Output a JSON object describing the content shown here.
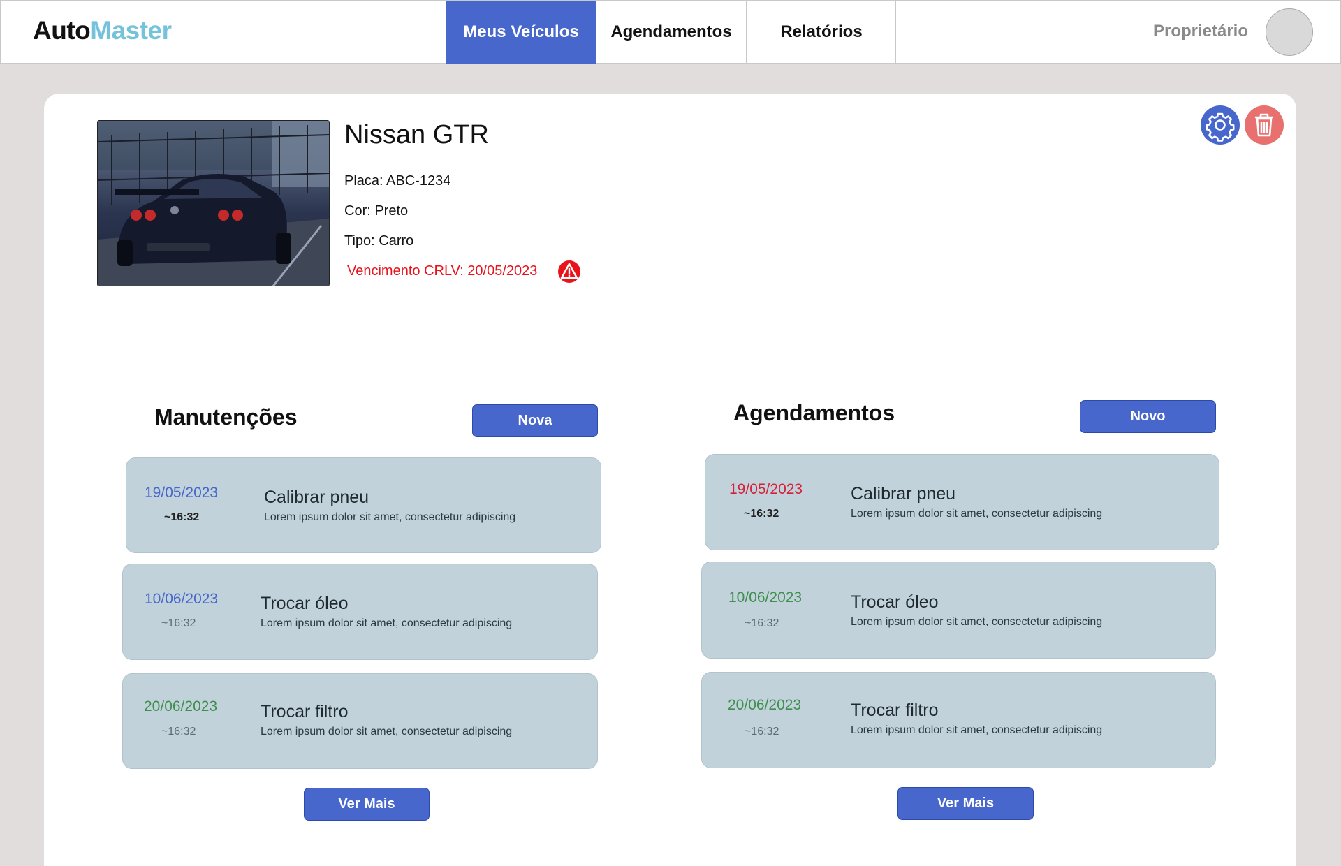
{
  "header": {
    "logo_part1": "Auto",
    "logo_part2": "Master",
    "tabs": [
      {
        "label": "Meus Veículos",
        "active": true
      },
      {
        "label": "Agendamentos",
        "active": false
      },
      {
        "label": "Relatórios",
        "active": false
      }
    ],
    "user_role": "Proprietário"
  },
  "vehicle": {
    "name": "Nissan GTR",
    "plate": "Placa: ABC-1234",
    "color": "Cor: Preto",
    "type": "Tipo: Carro",
    "crlv_due": "Vencimento CRLV: 20/05/2023"
  },
  "maintenance": {
    "title": "Manutenções",
    "new_button": "Nova",
    "more_button": "Ver Mais",
    "items": [
      {
        "date": "19/05/2023",
        "time": "~16:32",
        "title": "Calibrar pneu",
        "desc": "Lorem ipsum dolor sit amet, consectetur adipiscing",
        "date_color": "#4767cc"
      },
      {
        "date": "10/06/2023",
        "time": "~16:32",
        "title": "Trocar óleo",
        "desc": "Lorem ipsum dolor sit amet, consectetur adipiscing",
        "date_color": "#4767cc"
      },
      {
        "date": "20/06/2023",
        "time": "~16:32",
        "title": "Trocar filtro",
        "desc": "Lorem ipsum dolor sit amet, consectetur adipiscing",
        "date_color": "#3e8f4e"
      }
    ]
  },
  "schedules": {
    "title": "Agendamentos",
    "new_button": "Novo",
    "more_button": "Ver Mais",
    "items": [
      {
        "date": "19/05/2023",
        "time": "~16:32",
        "title": "Calibrar pneu",
        "desc": "Lorem ipsum dolor sit amet, consectetur adipiscing",
        "date_color": "#d61f3a"
      },
      {
        "date": "10/06/2023",
        "time": "~16:32",
        "title": "Trocar óleo",
        "desc": "Lorem ipsum dolor sit amet, consectetur adipiscing",
        "date_color": "#3e8f4e"
      },
      {
        "date": "20/06/2023",
        "time": "~16:32",
        "title": "Trocar filtro",
        "desc": "Lorem ipsum dolor sit amet, consectetur adipiscing",
        "date_color": "#3e8f4e"
      }
    ]
  },
  "colors": {
    "accent": "#4767cc",
    "logo_accent": "#74c3da",
    "warning": "#e8131b",
    "item_bg": "#c2d2da",
    "delete": "#e8706f"
  }
}
